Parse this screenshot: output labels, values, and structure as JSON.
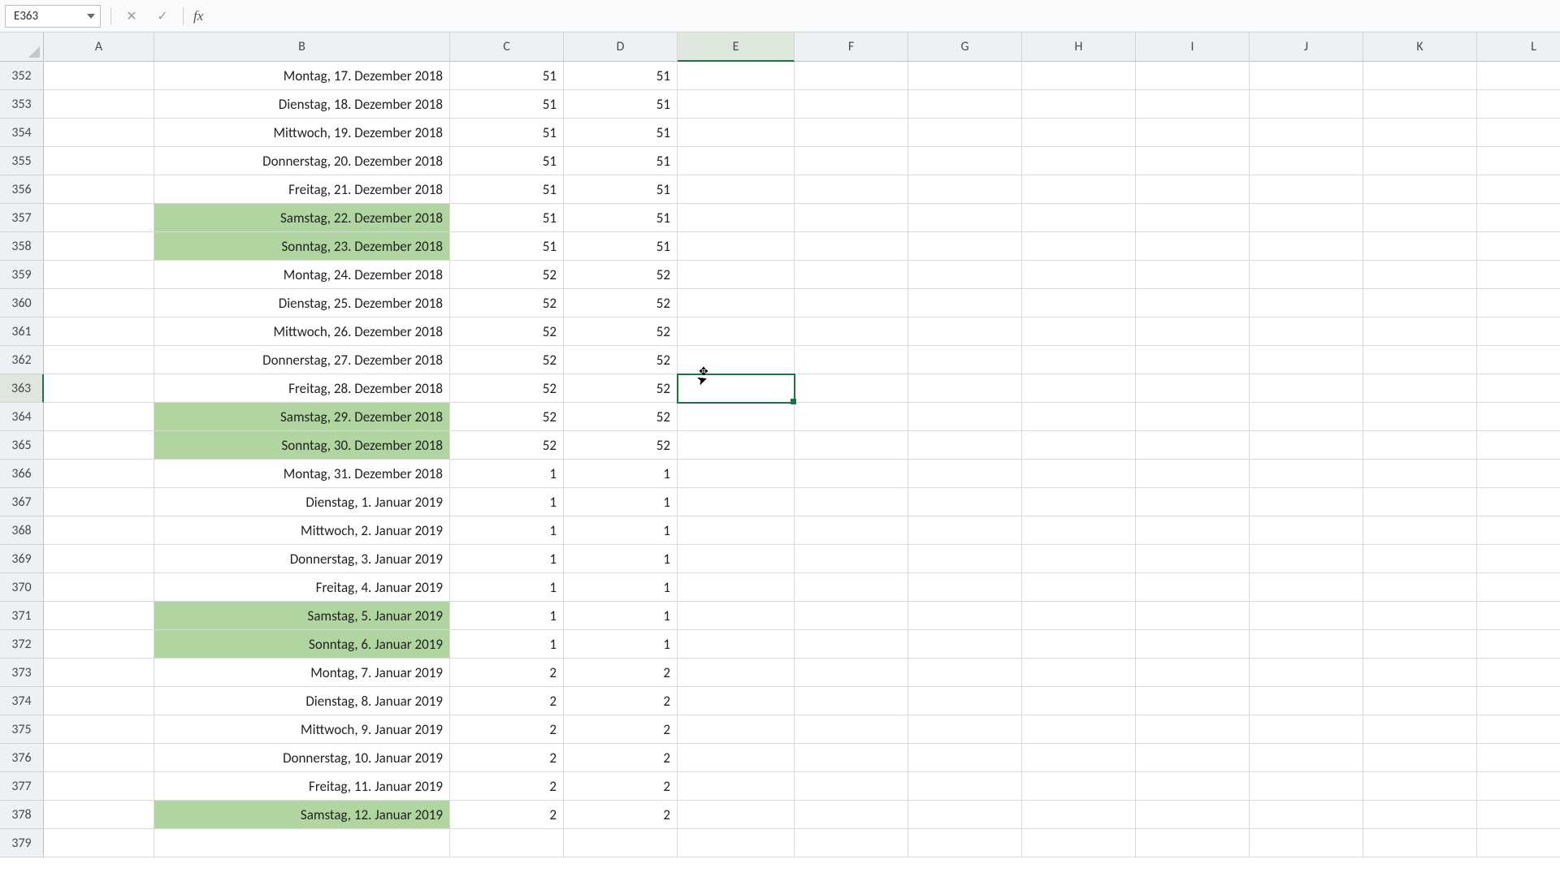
{
  "namebox": "E363",
  "formula": "",
  "fx_label": "fx",
  "columns": [
    "A",
    "B",
    "C",
    "D",
    "E",
    "F",
    "G",
    "H",
    "I",
    "J",
    "K",
    "L"
  ],
  "active_col": "E",
  "active_row": 363,
  "selected_cell": "E363",
  "rows": [
    {
      "n": 352,
      "b": "Montag, 17. Dezember 2018",
      "c": "51",
      "d": "51",
      "weekend": false
    },
    {
      "n": 353,
      "b": "Dienstag, 18. Dezember 2018",
      "c": "51",
      "d": "51",
      "weekend": false
    },
    {
      "n": 354,
      "b": "Mittwoch, 19. Dezember 2018",
      "c": "51",
      "d": "51",
      "weekend": false
    },
    {
      "n": 355,
      "b": "Donnerstag, 20. Dezember 2018",
      "c": "51",
      "d": "51",
      "weekend": false
    },
    {
      "n": 356,
      "b": "Freitag, 21. Dezember 2018",
      "c": "51",
      "d": "51",
      "weekend": false
    },
    {
      "n": 357,
      "b": "Samstag, 22. Dezember 2018",
      "c": "51",
      "d": "51",
      "weekend": true
    },
    {
      "n": 358,
      "b": "Sonntag, 23. Dezember 2018",
      "c": "51",
      "d": "51",
      "weekend": true
    },
    {
      "n": 359,
      "b": "Montag, 24. Dezember 2018",
      "c": "52",
      "d": "52",
      "weekend": false
    },
    {
      "n": 360,
      "b": "Dienstag, 25. Dezember 2018",
      "c": "52",
      "d": "52",
      "weekend": false
    },
    {
      "n": 361,
      "b": "Mittwoch, 26. Dezember 2018",
      "c": "52",
      "d": "52",
      "weekend": false
    },
    {
      "n": 362,
      "b": "Donnerstag, 27. Dezember 2018",
      "c": "52",
      "d": "52",
      "weekend": false
    },
    {
      "n": 363,
      "b": "Freitag, 28. Dezember 2018",
      "c": "52",
      "d": "52",
      "weekend": false
    },
    {
      "n": 364,
      "b": "Samstag, 29. Dezember 2018",
      "c": "52",
      "d": "52",
      "weekend": true
    },
    {
      "n": 365,
      "b": "Sonntag, 30. Dezember 2018",
      "c": "52",
      "d": "52",
      "weekend": true
    },
    {
      "n": 366,
      "b": "Montag, 31. Dezember 2018",
      "c": "1",
      "d": "1",
      "weekend": false
    },
    {
      "n": 367,
      "b": "Dienstag, 1. Januar 2019",
      "c": "1",
      "d": "1",
      "weekend": false
    },
    {
      "n": 368,
      "b": "Mittwoch, 2. Januar 2019",
      "c": "1",
      "d": "1",
      "weekend": false
    },
    {
      "n": 369,
      "b": "Donnerstag, 3. Januar 2019",
      "c": "1",
      "d": "1",
      "weekend": false
    },
    {
      "n": 370,
      "b": "Freitag, 4. Januar 2019",
      "c": "1",
      "d": "1",
      "weekend": false
    },
    {
      "n": 371,
      "b": "Samstag, 5. Januar 2019",
      "c": "1",
      "d": "1",
      "weekend": true
    },
    {
      "n": 372,
      "b": "Sonntag, 6. Januar 2019",
      "c": "1",
      "d": "1",
      "weekend": true
    },
    {
      "n": 373,
      "b": "Montag, 7. Januar 2019",
      "c": "2",
      "d": "2",
      "weekend": false
    },
    {
      "n": 374,
      "b": "Dienstag, 8. Januar 2019",
      "c": "2",
      "d": "2",
      "weekend": false
    },
    {
      "n": 375,
      "b": "Mittwoch, 9. Januar 2019",
      "c": "2",
      "d": "2",
      "weekend": false
    },
    {
      "n": 376,
      "b": "Donnerstag, 10. Januar 2019",
      "c": "2",
      "d": "2",
      "weekend": false
    },
    {
      "n": 377,
      "b": "Freitag, 11. Januar 2019",
      "c": "2",
      "d": "2",
      "weekend": false
    },
    {
      "n": 378,
      "b": "Samstag, 12. Januar 2019",
      "c": "2",
      "d": "2",
      "weekend": true
    },
    {
      "n": 379,
      "b": "",
      "c": "",
      "d": "",
      "weekend": false
    }
  ]
}
